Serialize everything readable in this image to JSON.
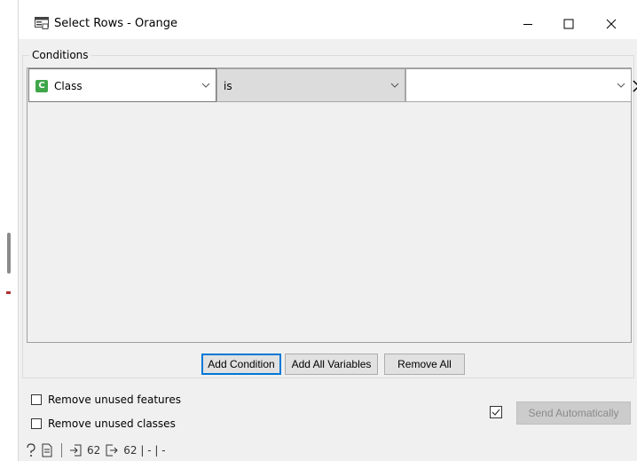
{
  "window": {
    "title": "Select Rows - Orange"
  },
  "conditions": {
    "group_label": "Conditions",
    "rows": [
      {
        "attribute": "Class",
        "attribute_type_badge": "C",
        "operator": "is",
        "value": ""
      }
    ]
  },
  "buttons": {
    "add_condition": "Add Condition",
    "add_all_variables": "Add All Variables",
    "remove_all": "Remove All"
  },
  "options": {
    "remove_unused_features": {
      "label": "Remove unused features",
      "checked": false
    },
    "remove_unused_classes": {
      "label": "Remove unused classes",
      "checked": false
    }
  },
  "send": {
    "label": "Send Automatically",
    "checked": true
  },
  "status_bar": {
    "input_count": "62",
    "output_summary": "62 | - | -"
  },
  "colors": {
    "badge_categorical": "#3fa64a",
    "focus_border": "#0078d7"
  }
}
